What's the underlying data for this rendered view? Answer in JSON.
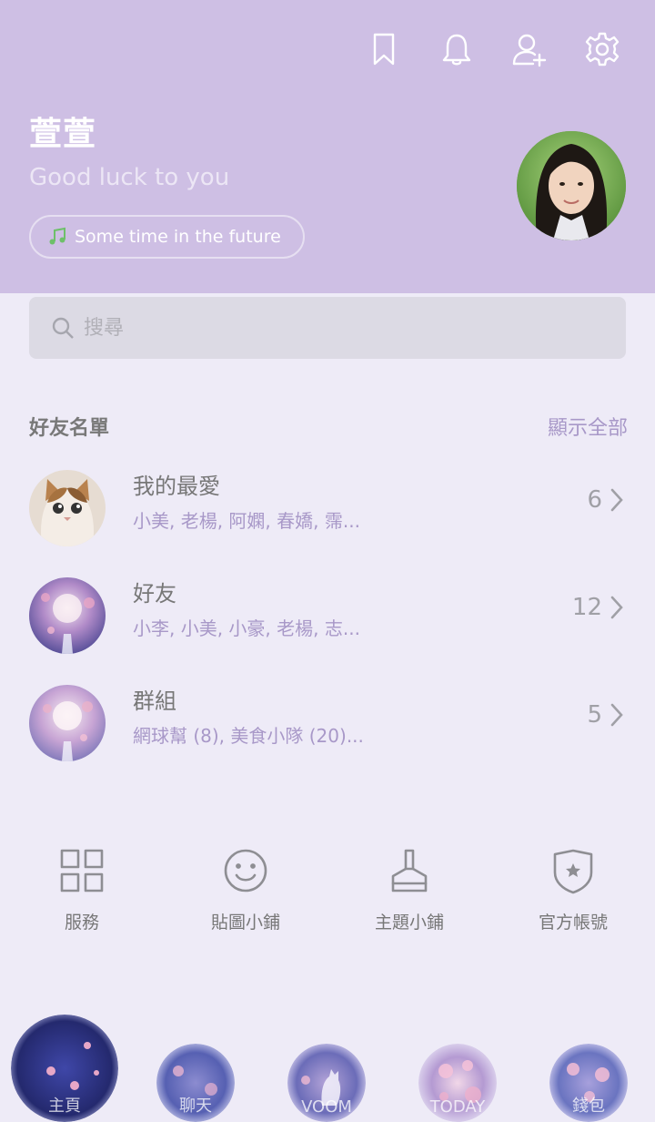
{
  "header": {
    "icons": [
      "bookmark-icon",
      "bell-icon",
      "add-friend-icon",
      "gear-icon"
    ],
    "profile_name": "萱萱",
    "status_message": "Good luck to you",
    "music": "Some time in the future"
  },
  "search": {
    "placeholder": "搜尋"
  },
  "friends_section": {
    "title": "好友名單",
    "show_all": "顯示全部",
    "rows": [
      {
        "title": "我的最愛",
        "members": "小美, 老楊, 阿嫻, 春嬌, 霈...",
        "count": "6"
      },
      {
        "title": "好友",
        "members": "小李, 小美, 小豪, 老楊, 志...",
        "count": "12"
      },
      {
        "title": "群組",
        "members": "網球幫 (8), 美食小隊 (20)...",
        "count": "5"
      }
    ]
  },
  "services": [
    {
      "label": "服務",
      "icon": "grid-icon"
    },
    {
      "label": "貼圖小鋪",
      "icon": "smiley-icon"
    },
    {
      "label": "主題小鋪",
      "icon": "brush-icon"
    },
    {
      "label": "官方帳號",
      "icon": "shield-star-icon"
    }
  ],
  "bottom_nav": [
    {
      "label": "主頁"
    },
    {
      "label": "聊天"
    },
    {
      "label": "VOOM"
    },
    {
      "label": "TODAY"
    },
    {
      "label": "錢包"
    }
  ],
  "colors": {
    "header_bg": "#cebfe4",
    "page_bg": "#eeebf7",
    "accent": "#a898c8"
  }
}
